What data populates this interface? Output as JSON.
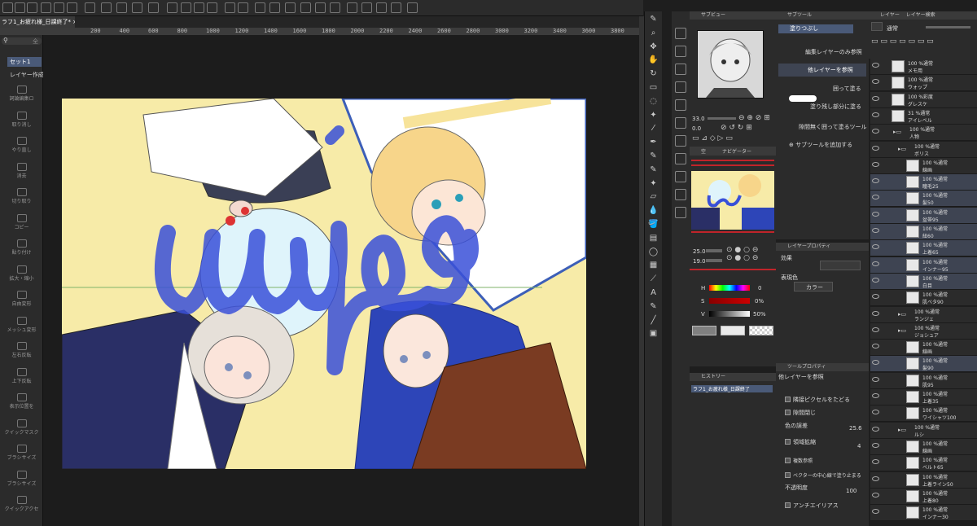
{
  "document": {
    "tab_title": "ラフ1_お疲れ様_日課終了* ×"
  },
  "ruler": {
    "ticks": [
      "200",
      "400",
      "600",
      "800",
      "1000",
      "1200",
      "1400",
      "1600",
      "1800",
      "2000",
      "2200",
      "2400",
      "2600",
      "2800",
      "3000",
      "3200",
      "3400",
      "3600",
      "3800",
      "4000",
      "4200"
    ]
  },
  "left_panel": {
    "search_placeholder": "全",
    "set_label": "セット1",
    "create_layer": "レイヤー作成",
    "items": [
      {
        "label": "詞論編集ロ",
        "icon": "speech-icon"
      },
      {
        "label": "取り消し",
        "icon": "undo-icon"
      },
      {
        "label": "やり直し",
        "icon": "redo-icon"
      },
      {
        "label": "消去",
        "icon": "erase-icon"
      },
      {
        "label": "切り取り",
        "icon": "scissors-icon"
      },
      {
        "label": "コピー",
        "icon": "copy-icon"
      },
      {
        "label": "貼り付け",
        "icon": "paste-icon"
      },
      {
        "label": "拡大・縮小",
        "icon": "scale-icon"
      },
      {
        "label": "自由変形",
        "icon": "transform-icon"
      },
      {
        "label": "メッシュ変形",
        "icon": "mesh-icon"
      },
      {
        "label": "左右反転",
        "icon": "flip-h-icon"
      },
      {
        "label": "上下反転",
        "icon": "flip-v-icon"
      },
      {
        "label": "表示位置を",
        "icon": "view-icon"
      },
      {
        "label": "クイックマスク",
        "icon": "mask-icon"
      },
      {
        "label": "ブラシサイズ",
        "icon": "brush-size-icon"
      },
      {
        "label": "ブラシサイズ",
        "icon": "brush-size-icon"
      },
      {
        "label": "クイックアクセ",
        "icon": "quick-icon"
      }
    ]
  },
  "canvas": {
    "stroke_text": "uujo"
  },
  "subview": {
    "title": "サブビュー"
  },
  "navigator": {
    "tab1": "空",
    "tab2": "ナビゲーター",
    "zoom_value": "33.0",
    "rotate_value": "0.0"
  },
  "subtool": {
    "title": "サブツール",
    "group": "塗りつぶし",
    "items": [
      "編集レイヤーのみ参照",
      "他レイヤーを参照",
      "囲って塗る",
      "塗り残し部分に塗る",
      "隙間無く囲って塗るツール"
    ],
    "add_label": "サブツールを追加する"
  },
  "color": {
    "size_value": "25.0",
    "opacity_value": "19.0",
    "h_label": "H",
    "h_value": "0",
    "s_label": "S",
    "s_value": "0%",
    "v_label": "V",
    "v_value": "50%"
  },
  "layer_property": {
    "title": "レイヤープロパティ",
    "effect_label": "効果",
    "expression_label": "表現色",
    "expression_value": "カラー"
  },
  "history": {
    "title": "ヒストリー",
    "entry": "ラフ1_お疲れ様_日課終了"
  },
  "tool_property": {
    "title": "ツールプロパティ",
    "tool_name": "他レイヤーを参照",
    "opt1": "隣接ピクセルをたどる",
    "opt2": "隙間閉じ",
    "opt3_label": "色の誤差",
    "opt3_value": "25.6",
    "opt4": "領域拡縮",
    "opt4_value": "4",
    "opt5": "複数参照",
    "opt6": "ベクターの中心線で塗り止まる",
    "opt7_label": "不透明度",
    "opt7_value": "100",
    "opt8": "アンチエイリアス"
  },
  "layers": {
    "tab1": "レイヤー",
    "tab2": "レイヤー検索",
    "blend_mode": "通常",
    "items": [
      {
        "l1": "100 %通常",
        "l2": "メモ用",
        "indent": 0
      },
      {
        "l1": "100 %通常",
        "l2": "ウォップ",
        "indent": 0
      },
      {
        "l1": "100 %彩度",
        "l2": "グレスケ",
        "indent": 0
      },
      {
        "l1": "31 %通常",
        "l2": "アイレベル",
        "indent": 0
      },
      {
        "l1": "100 %通常",
        "l2": "人物",
        "indent": 1,
        "folder": true
      },
      {
        "l1": "100 %通常",
        "l2": "ボリス",
        "indent": 2,
        "folder": true
      },
      {
        "l1": "100 %通常",
        "l2": "線画",
        "indent": 3
      },
      {
        "l1": "100 %通常",
        "l2": "瞳毛25",
        "indent": 3
      },
      {
        "l1": "100 %通常",
        "l2": "髪50",
        "indent": 3
      },
      {
        "l1": "100 %通常",
        "l2": "盆帯95",
        "indent": 3
      },
      {
        "l1": "100 %通常",
        "l2": "紐60",
        "indent": 3
      },
      {
        "l1": "100 %通常",
        "l2": "上着65",
        "indent": 3
      },
      {
        "l1": "100 %通常",
        "l2": "インナー95",
        "indent": 3
      },
      {
        "l1": "100 %通常",
        "l2": "白目",
        "indent": 3
      },
      {
        "l1": "100 %通常",
        "l2": "肌ベタ90",
        "indent": 3
      },
      {
        "l1": "100 %通常",
        "l2": "ランジェ",
        "indent": 2,
        "folder": true
      },
      {
        "l1": "100 %通常",
        "l2": "ジョシュア",
        "indent": 2,
        "folder": true
      },
      {
        "l1": "100 %通常",
        "l2": "線画",
        "indent": 3
      },
      {
        "l1": "100 %通常",
        "l2": "髪90",
        "indent": 3
      },
      {
        "l1": "100 %通常",
        "l2": "肌95",
        "indent": 3
      },
      {
        "l1": "100 %通常",
        "l2": "上着35",
        "indent": 3
      },
      {
        "l1": "100 %通常",
        "l2": "ワイシャツ100",
        "indent": 3
      },
      {
        "l1": "100 %通常",
        "l2": "ルシ",
        "indent": 2,
        "folder": true
      },
      {
        "l1": "100 %通常",
        "l2": "線画",
        "indent": 3
      },
      {
        "l1": "100 %通常",
        "l2": "ベルト65",
        "indent": 3
      },
      {
        "l1": "100 %通常",
        "l2": "上着ライン50",
        "indent": 3
      },
      {
        "l1": "100 %通常",
        "l2": "上着80",
        "indent": 3
      },
      {
        "l1": "100 %通常",
        "l2": "インナー30",
        "indent": 3
      }
    ]
  }
}
